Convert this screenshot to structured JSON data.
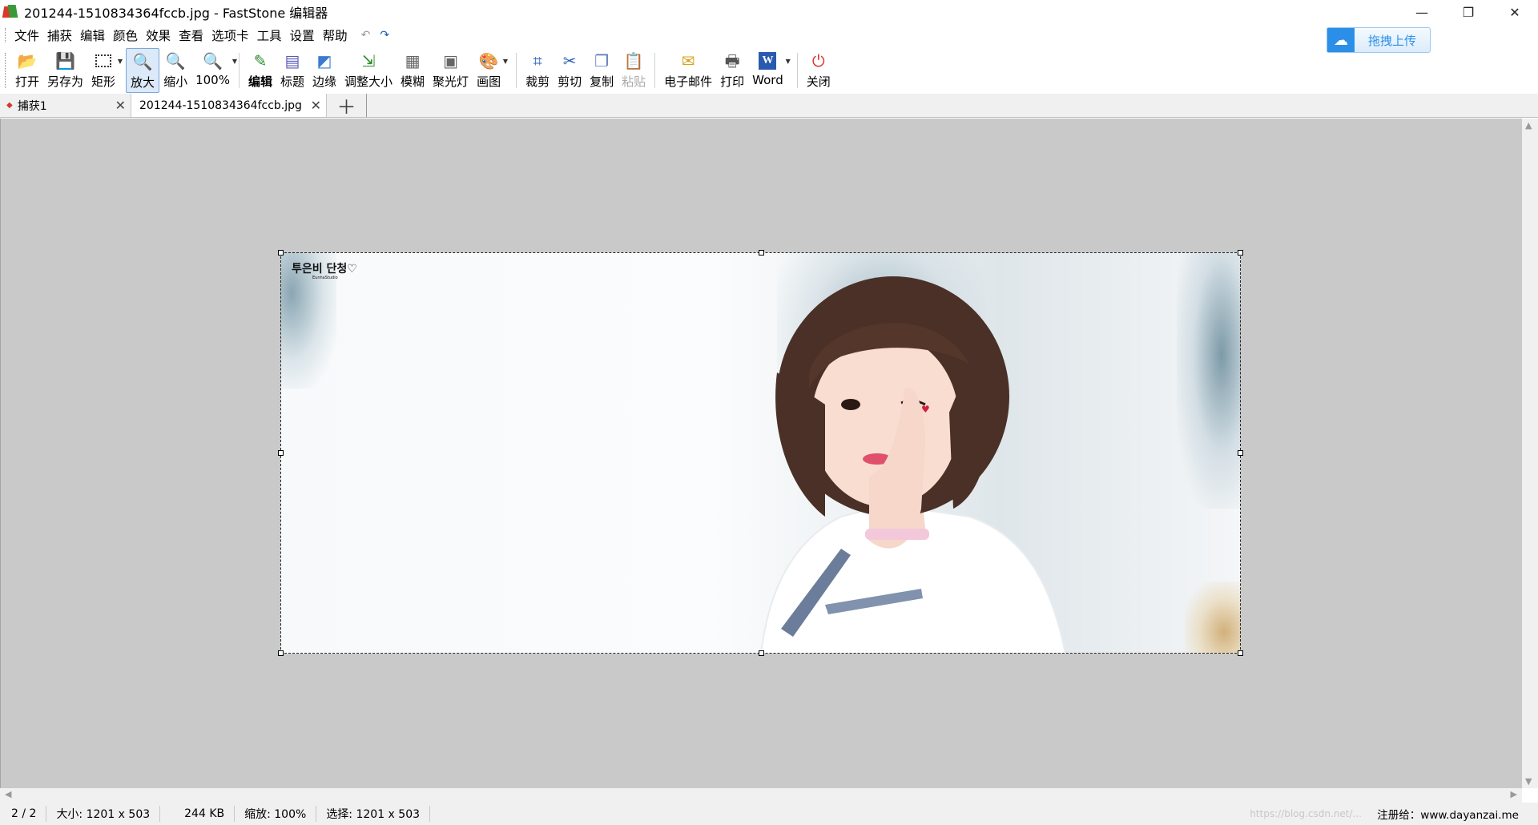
{
  "window": {
    "title": "201244-1510834364fccb.jpg - FastStone 编辑器",
    "minimize": "—",
    "restore": "❐",
    "close": "✕"
  },
  "menu": {
    "items": [
      "文件",
      "捕获",
      "编辑",
      "颜色",
      "效果",
      "查看",
      "选项卡",
      "工具",
      "设置",
      "帮助"
    ],
    "undo": "↶",
    "redo": "↷"
  },
  "upload": {
    "label": "拖拽上传",
    "icon": "cloud-icon"
  },
  "toolbar": {
    "open": "打开",
    "save_as": "另存为",
    "rect": "矩形",
    "zoom_in": "放大",
    "zoom_out": "缩小",
    "zoom_level": "100%",
    "edit": "编辑",
    "caption": "标题",
    "edge": "边缘",
    "resize": "调整大小",
    "blur": "模糊",
    "spotlight": "聚光灯",
    "draw": "画图",
    "crop": "裁剪",
    "cut": "剪切",
    "copy": "复制",
    "paste": "粘贴",
    "email": "电子邮件",
    "print": "打印",
    "word": "Word",
    "close": "关闭"
  },
  "tabs": [
    {
      "label": "捕获1",
      "active": false
    },
    {
      "label": "201244-1510834364fccb.jpg",
      "active": true
    }
  ],
  "image": {
    "watermark": "투은비 단청♡",
    "watermark_sub": "EunhaStudio"
  },
  "status": {
    "page": "2 / 2",
    "size": "大小: 1201 x 503",
    "filesize": "244 KB",
    "zoom": "缩放: 100%",
    "selection": "选择: 1201 x 503",
    "registered": "注册给：www.dayanzai.me",
    "watermark": "https://blog.csdn.net/..."
  },
  "colors": {
    "accent": "#2b8fe8",
    "canvas": "#c9c9c9",
    "status_bar": "#f0f0f0"
  }
}
